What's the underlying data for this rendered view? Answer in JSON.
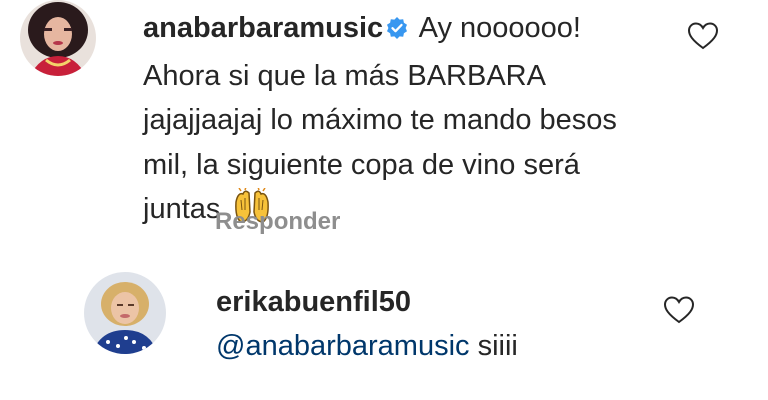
{
  "comments": [
    {
      "username": "anabarbaramusic",
      "verified": true,
      "text": "Ay noooooo! Ahora si que la más BARBARA jajajjaajaj lo máximo te mando besos mil, la siguiente copa de vino será juntas",
      "emoji": "raising-hands",
      "reply_label": "Responder",
      "liked": false
    },
    {
      "username": "erikabuenfil50",
      "mention": "@anabarbaramusic",
      "text": "siiii",
      "liked": false
    }
  ],
  "colors": {
    "text": "#262626",
    "muted": "#8e8e8e",
    "mention": "#00376b",
    "verified": "#3897f0"
  }
}
